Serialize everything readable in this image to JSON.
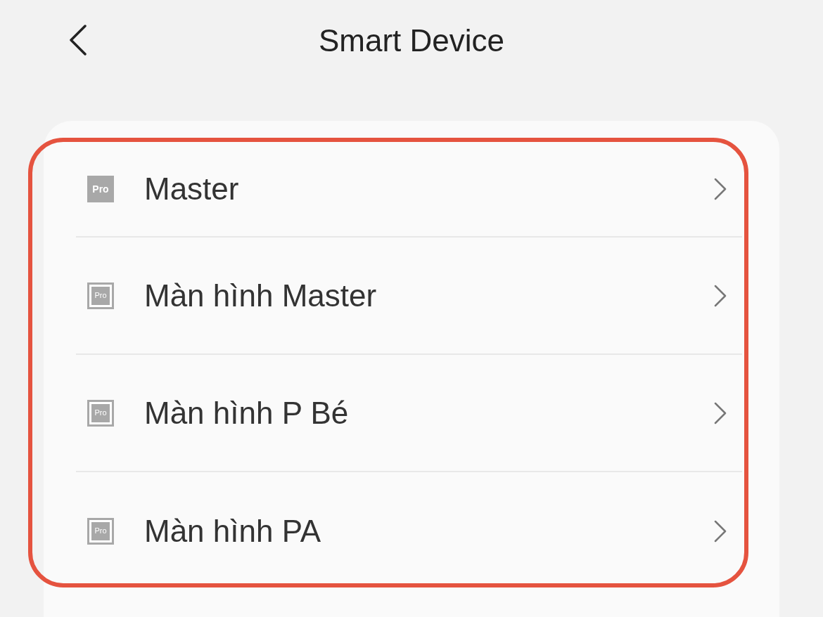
{
  "header": {
    "title": "Smart Device"
  },
  "device_list": {
    "highlighted": true,
    "items": [
      {
        "name": "Master",
        "icon_label": "Pro",
        "kind": "filled"
      },
      {
        "name": "Màn hình Master",
        "icon_label": "Pro",
        "kind": "framed"
      },
      {
        "name": "Màn hình P Bé",
        "icon_label": "Pro",
        "kind": "framed"
      },
      {
        "name": "Màn hình PA",
        "icon_label": "Pro",
        "kind": "framed"
      }
    ]
  }
}
